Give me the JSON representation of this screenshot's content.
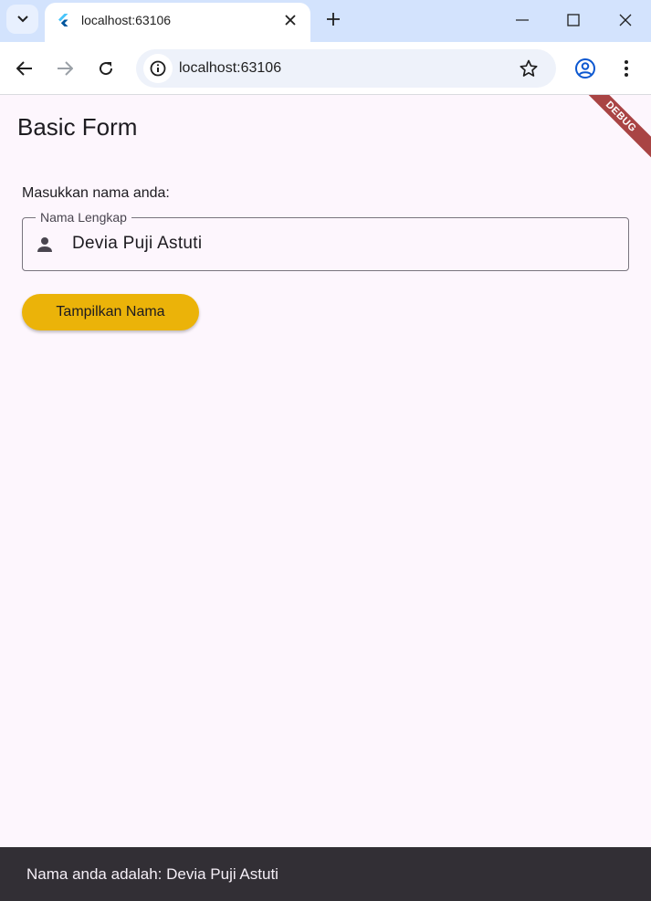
{
  "browser": {
    "tab_title": "localhost:63106",
    "url": "localhost:63106"
  },
  "app": {
    "title": "Basic Form",
    "debug_banner": "DEBUG",
    "prompt_label": "Masukkan nama anda:",
    "name_field": {
      "label": "Nama Lengkap",
      "value": "Devia Puji Astuti",
      "icon": "person-icon"
    },
    "submit_label": "Tampilkan Nama",
    "snackbar_message": "Nama anda adalah: Devia Puji Astuti"
  },
  "colors": {
    "background": "#fdf6fd",
    "button": "#ebb309",
    "snackbar": "#322f35",
    "debug_banner": "#a94444"
  }
}
